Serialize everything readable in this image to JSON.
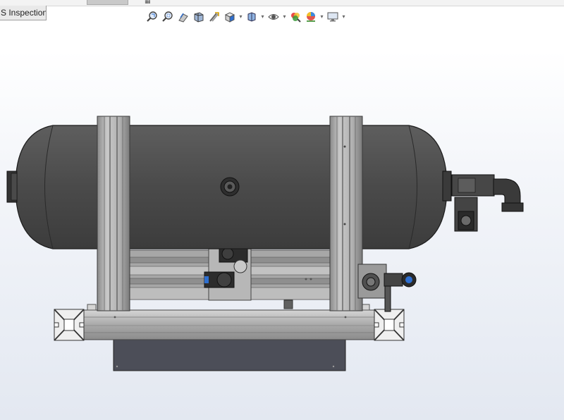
{
  "tab": {
    "label": "S Inspection"
  },
  "toolbar": {
    "items": [
      {
        "name": "zoom-to-fit-icon",
        "dropdown": false
      },
      {
        "name": "zoom-to-area-icon",
        "dropdown": false
      },
      {
        "name": "previous-view-icon",
        "dropdown": false
      },
      {
        "name": "section-view-icon",
        "dropdown": false
      },
      {
        "name": "dynamic-annotation-icon",
        "dropdown": false
      },
      {
        "name": "view-orientation-icon",
        "dropdown": true
      },
      {
        "name": "display-style-icon",
        "dropdown": true
      },
      {
        "name": "hide-show-items-icon",
        "dropdown": true
      },
      {
        "name": "edit-appearance-icon",
        "dropdown": false
      },
      {
        "name": "apply-scene-icon",
        "dropdown": true
      },
      {
        "name": "view-settings-icon",
        "dropdown": true
      }
    ]
  },
  "colors": {
    "tank": "#4a4a4a",
    "frame": "#b8b8b8",
    "frame_dark": "#7c7c7c",
    "base_block": "#4c4e58",
    "accent_blue": "#2e6fd0"
  }
}
